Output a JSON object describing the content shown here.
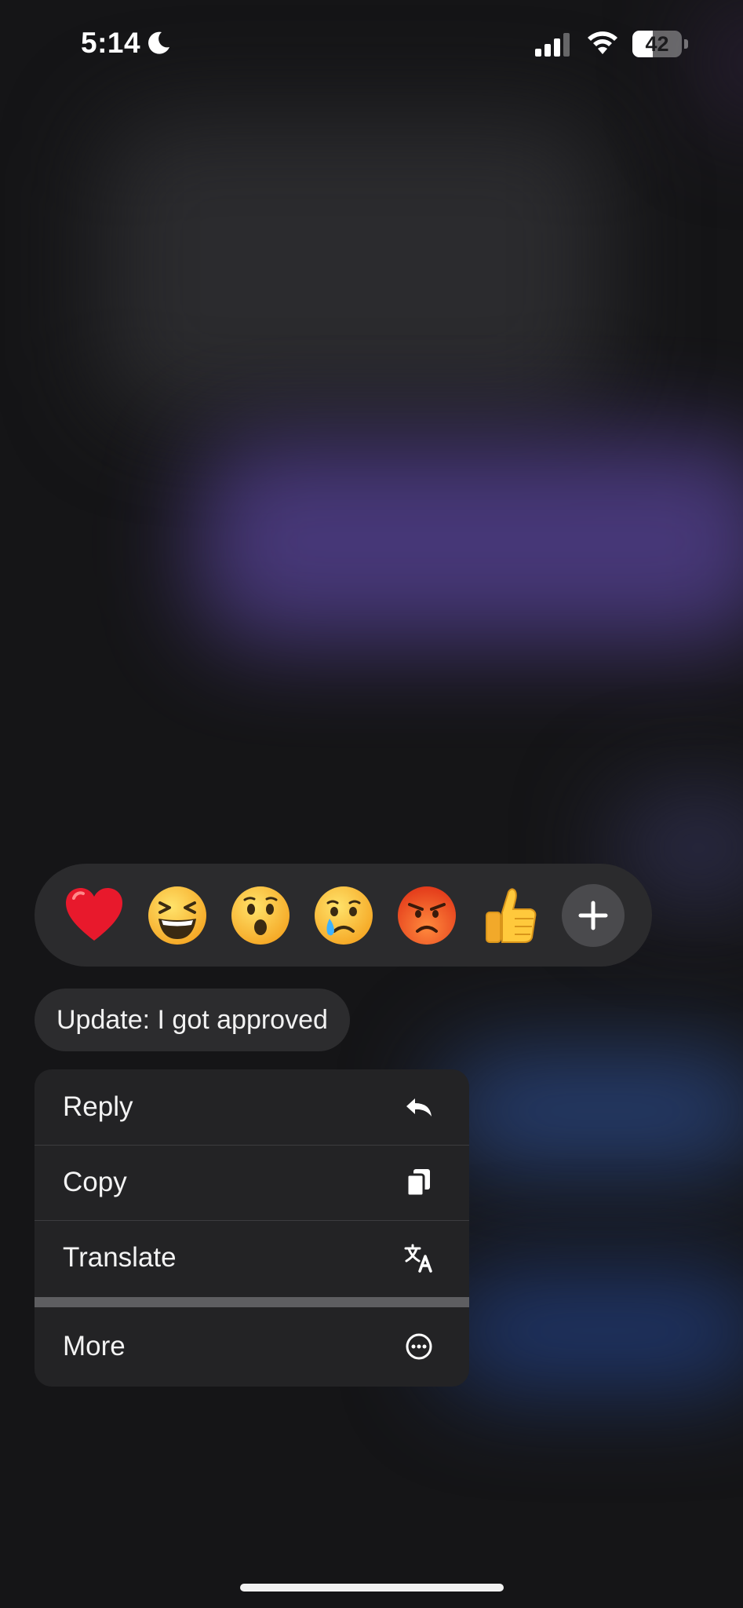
{
  "status_bar": {
    "time": "5:14",
    "focus_icon": "moon-icon",
    "battery_level": "42",
    "battery_fraction": 0.42
  },
  "reactions": [
    {
      "name": "red-heart",
      "icon": "heart-emoji"
    },
    {
      "name": "laughing-face",
      "icon": "laughing-emoji"
    },
    {
      "name": "surprised-face",
      "icon": "surprised-emoji"
    },
    {
      "name": "crying-face",
      "icon": "crying-emoji"
    },
    {
      "name": "angry-face",
      "icon": "angry-emoji"
    },
    {
      "name": "thumbs-up",
      "icon": "thumbs-up-emoji"
    }
  ],
  "add_reaction_icon": "plus-icon",
  "message": {
    "text": "Update: I got approved"
  },
  "menu": {
    "reply": {
      "label": "Reply",
      "icon": "reply-arrow-icon"
    },
    "copy": {
      "label": "Copy",
      "icon": "copy-icon"
    },
    "translate": {
      "label": "Translate",
      "icon": "translate-icon"
    },
    "more": {
      "label": "More",
      "icon": "more-circle-icon"
    }
  },
  "colors": {
    "accent_background": "#151517",
    "bubble": "#2c2c2e",
    "menu": "#232325"
  }
}
